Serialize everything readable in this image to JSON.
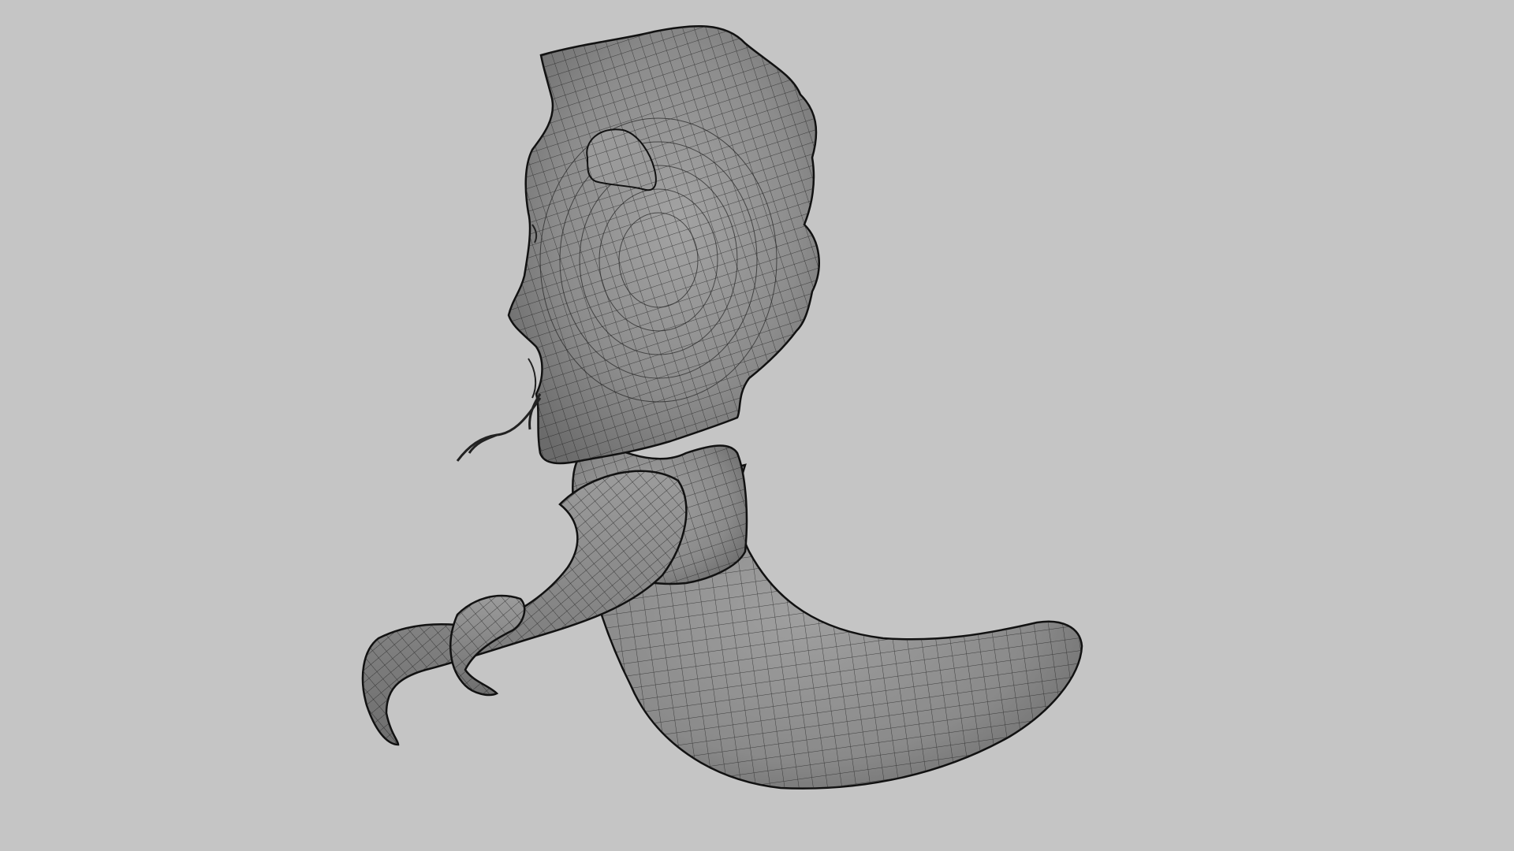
{
  "viewport": {
    "background_color": "#c5c5c5",
    "shading": "smooth-shaded-with-wireframe",
    "view": "side"
  },
  "model": {
    "subject": "creature",
    "surface_color": "#8a8a8a",
    "wire_color": "#1e1e1e",
    "parts": [
      "head",
      "brow-horn",
      "mouth",
      "whiskers",
      "neck",
      "body",
      "arm",
      "hand",
      "claw",
      "tail"
    ]
  }
}
